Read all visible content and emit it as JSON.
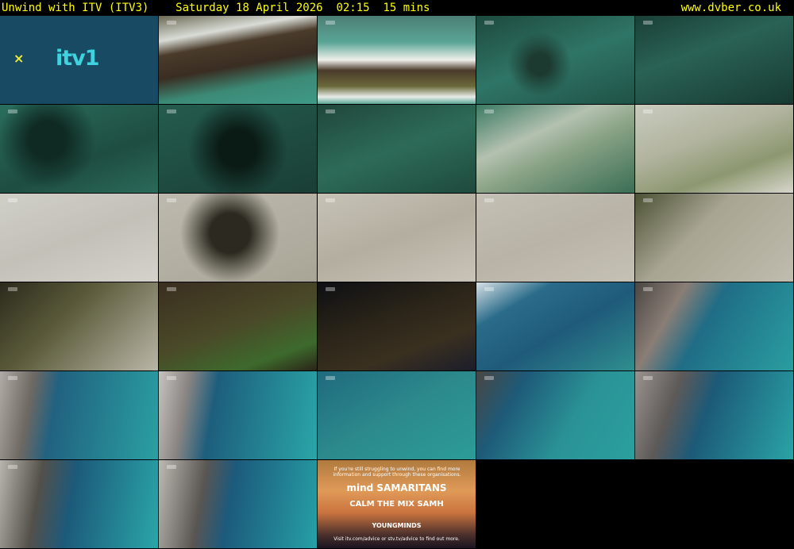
{
  "header": {
    "title": "Unwind with ITV (ITV3)",
    "datetime": "Saturday 18 April 2026  02:15  15 mins",
    "site": "www.dvber.co.uk"
  },
  "ident": {
    "symbol": "×",
    "logo": "itv1"
  },
  "helpline": {
    "intro": "If you're still struggling to unwind, you can find more information and support through these organisations.",
    "row1": "mind  SAMARITANS",
    "row2": "CALM  THE MIX  SAMH",
    "row3": "YOUNGMINDS",
    "footer": "Visit itv.com/advice or stv.tv/advice to find out more."
  },
  "tiles": [
    {
      "kind": "ident"
    },
    {
      "kind": "img",
      "bg": "linear-gradient(170deg,#6b6a55 0%,#d9dcd6 22%,#4a3b2a 35%,#3a2d22 55%,#3c8a76 75%,#3f9987 100%)"
    },
    {
      "kind": "img",
      "bg": "linear-gradient(180deg,#4c7e74 0%,#5aa596 30%,#f0f0ea 50%,#4a3a2a 62%,#6a6a3a 80%,#e8ece8 92%,#5aa596 100%)"
    },
    {
      "kind": "img",
      "bg": "radial-gradient(circle at 40% 55%,#1d3a30 10%,transparent 30%),linear-gradient(160deg,#1d4a3e 0%,#2f7566 50%,#1f5247 100%)"
    },
    {
      "kind": "img",
      "bg": "linear-gradient(160deg,#1a3f36 0%,#2a6256 40%,#173a32 100%)"
    },
    {
      "kind": "img",
      "bg": "radial-gradient(circle at 30% 40%,#0f2a22 15%,transparent 40%),linear-gradient(160deg,#2a6e5e 0%,#1e4d41 60%,#2a6a5a 100%)"
    },
    {
      "kind": "img",
      "bg": "radial-gradient(circle at 50% 50%,#0a1a14 20%,transparent 55%),linear-gradient(160deg,#245c4e 0%,#1a3e35 100%)"
    },
    {
      "kind": "img",
      "bg": "linear-gradient(160deg,#20473b 0%,#2d6b58 50%,#1e4a3d 100%)"
    },
    {
      "kind": "img",
      "bg": "linear-gradient(155deg,#3b7a63 0%,#b4c1b0 35%,#8aa386 55%,#3a6e55 100%)"
    },
    {
      "kind": "img",
      "bg": "linear-gradient(160deg,#c9cbbf 0%,#b2b49f 40%,#8c9870 70%,#d8d6cc 100%)"
    },
    {
      "kind": "img",
      "bg": "linear-gradient(160deg,#cfcfc8 0%,#c3c0b8 50%,#d5d2cb 100%)"
    },
    {
      "kind": "img",
      "bg": "radial-gradient(circle at 45% 45%,#2c2a20 20%,transparent 50%),linear-gradient(160deg,#bdb9ae 0%,#a9a596 100%)"
    },
    {
      "kind": "img",
      "bg": "linear-gradient(160deg,#c6c2b6 0%,#b3ae9f 50%,#c9c4b8 100%)"
    },
    {
      "kind": "img",
      "bg": "linear-gradient(160deg,#c4c0b5 0%,#b8b3a6 50%,#c6c1b5 100%)"
    },
    {
      "kind": "img",
      "bg": "linear-gradient(135deg,#4b5134 0%,#a8a592 40%,#c0bcae 100%)"
    },
    {
      "kind": "img",
      "bg": "linear-gradient(135deg,#2c2a1c 0%,#5b5b3a 40%,#bab6a8 100%)"
    },
    {
      "kind": "img",
      "bg": "linear-gradient(160deg,#3a2e20 0%,#4a4a28 50%,#3d6a2c 80%,#2a2418 100%)"
    },
    {
      "kind": "img",
      "bg": "linear-gradient(160deg,#0e0f14 0%,#2a2418 40%,#3a3020 70%,#1b1d2a 100%)"
    },
    {
      "kind": "img",
      "bg": "linear-gradient(150deg,#d7e0e4 0%,#2b6c8a 25%,#1f5a7a 55%,#2f8f8f 100%)"
    },
    {
      "kind": "img",
      "bg": "linear-gradient(120deg,#4a4642 0%,#8a7e76 25%,#1f6d86 45%,#2a9ea0 100%)"
    },
    {
      "kind": "img",
      "bg": "linear-gradient(100deg,#b0aba6 0%,#6e6862 20%,#216280 35%,#2aa0a2 100%)"
    },
    {
      "kind": "img",
      "bg": "linear-gradient(100deg,#c7c3bf 0%,#8a8582 18%,#1d5e7c 35%,#2aa6a8 100%)"
    },
    {
      "kind": "img",
      "bg": "linear-gradient(150deg,#1f6a7e 0%,#2c8a8c 50%,#2c9c98 100%)"
    },
    {
      "kind": "img",
      "bg": "linear-gradient(120deg,#4a4642 0%,#1e5a78 25%,#2a9296 60%,#2aa09e 100%)"
    },
    {
      "kind": "img",
      "bg": "linear-gradient(110deg,#9a9490 0%,#5e5a58 25%,#1c5a78 45%,#2aa4a6 100%)"
    },
    {
      "kind": "img",
      "bg": "linear-gradient(100deg,#b8b4ae 0%,#54504a 25%,#1c5a7a 45%,#2aa6a8 100%)"
    },
    {
      "kind": "img",
      "bg": "linear-gradient(100deg,#bdb9b3 0%,#5a5652 28%,#1c5a7c 45%,#26a0a6 100%)"
    },
    {
      "kind": "help"
    },
    {
      "kind": "blank"
    },
    {
      "kind": "blank"
    }
  ]
}
